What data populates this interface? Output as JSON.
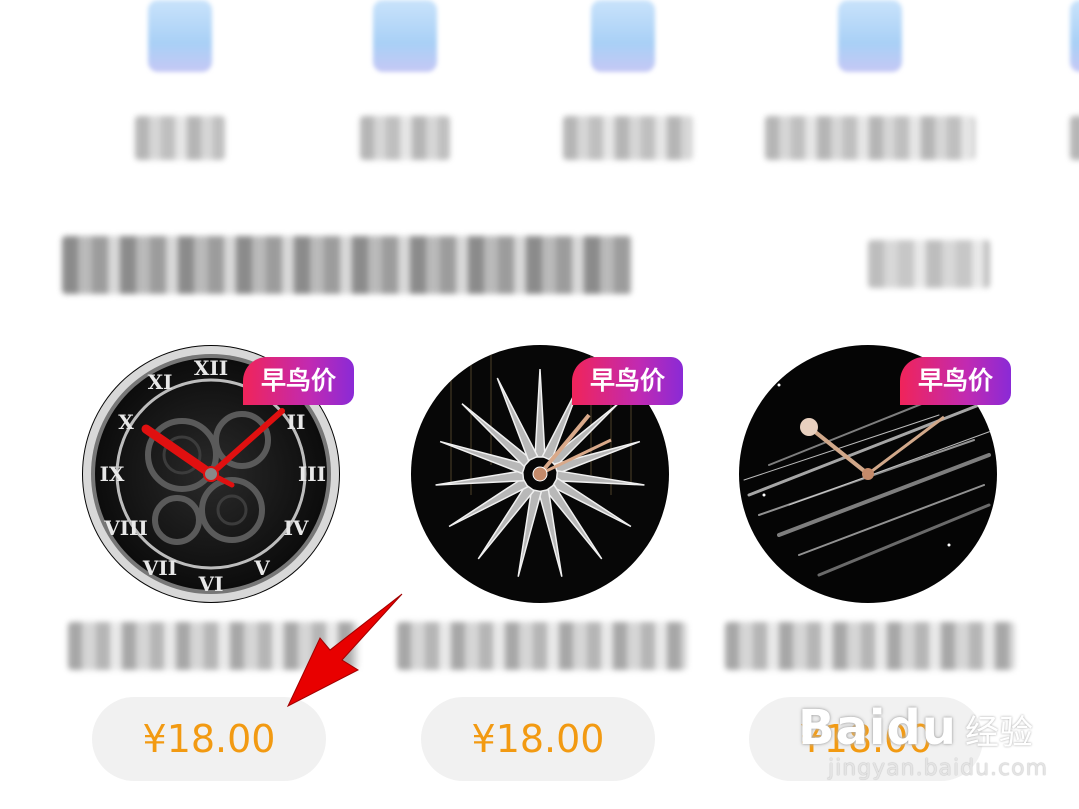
{
  "categories": [
    {
      "icon": "category-icon-1"
    },
    {
      "icon": "category-icon-2"
    },
    {
      "icon": "category-icon-3"
    },
    {
      "icon": "category-icon-4"
    },
    {
      "icon": "category-icon-5"
    }
  ],
  "products": [
    {
      "badge": "早鸟价",
      "price": "¥18.00",
      "face": "skeleton-watch-face"
    },
    {
      "badge": "早鸟价",
      "price": "¥18.00",
      "face": "diamond-watch-face"
    },
    {
      "badge": "早鸟价",
      "price": "¥18.00",
      "face": "meteor-watch-face"
    }
  ],
  "watermark": {
    "logo": "Baidu",
    "suffix": "经验",
    "url": "jingyan.baidu.com"
  },
  "colors": {
    "price": "#f29a12",
    "badge_start": "#f0245a",
    "badge_end": "#8a2ad6",
    "annotation_arrow": "#e00000"
  }
}
